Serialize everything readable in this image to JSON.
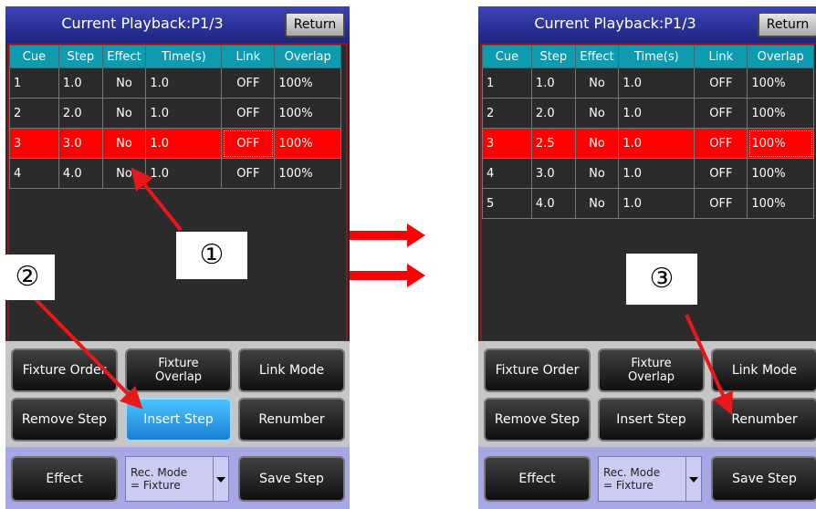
{
  "left": {
    "title": "Current Playback:P1/3",
    "return_label": "Return",
    "columns": [
      "Cue",
      "Step",
      "Effect",
      "Time(s)",
      "Link",
      "Overlap"
    ],
    "rows": [
      {
        "cue": "1",
        "step": "1.0",
        "effect": "No",
        "time": "1.0",
        "link": "OFF",
        "overlap": "100%"
      },
      {
        "cue": "2",
        "step": "2.0",
        "effect": "No",
        "time": "1.0",
        "link": "OFF",
        "overlap": "100%"
      },
      {
        "cue": "3",
        "step": "3.0",
        "effect": "No",
        "time": "1.0",
        "link": "OFF",
        "overlap": "100%"
      },
      {
        "cue": "4",
        "step": "4.0",
        "effect": "No",
        "time": "1.0",
        "link": "OFF",
        "overlap": "100%"
      }
    ],
    "buttons": {
      "fixture_order": "Fixture Order",
      "fixture_overlap_1": "Fixture",
      "fixture_overlap_2": "Overlap",
      "link_mode": "Link Mode",
      "remove_step": "Remove Step",
      "insert_step": "Insert Step",
      "renumber": "Renumber",
      "effect": "Effect",
      "rec_mode_1": "Rec. Mode",
      "rec_mode_2": "= Fixture",
      "save_step": "Save Step"
    }
  },
  "right": {
    "title": "Current Playback:P1/3",
    "return_label": "Return",
    "columns": [
      "Cue",
      "Step",
      "Effect",
      "Time(s)",
      "Link",
      "Overlap"
    ],
    "rows": [
      {
        "cue": "1",
        "step": "1.0",
        "effect": "No",
        "time": "1.0",
        "link": "OFF",
        "overlap": "100%"
      },
      {
        "cue": "2",
        "step": "2.0",
        "effect": "No",
        "time": "1.0",
        "link": "OFF",
        "overlap": "100%"
      },
      {
        "cue": "3",
        "step": "2.5",
        "effect": "No",
        "time": "1.0",
        "link": "OFF",
        "overlap": "100%"
      },
      {
        "cue": "4",
        "step": "3.0",
        "effect": "No",
        "time": "1.0",
        "link": "OFF",
        "overlap": "100%"
      },
      {
        "cue": "5",
        "step": "4.0",
        "effect": "No",
        "time": "1.0",
        "link": "OFF",
        "overlap": "100%"
      }
    ],
    "buttons": {
      "fixture_order": "Fixture Order",
      "fixture_overlap_1": "Fixture",
      "fixture_overlap_2": "Overlap",
      "link_mode": "Link Mode",
      "remove_step": "Remove Step",
      "insert_step": "Insert Step",
      "renumber": "Renumber",
      "effect": "Effect",
      "rec_mode_1": "Rec. Mode",
      "rec_mode_2": "= Fixture",
      "save_step": "Save Step"
    }
  },
  "annotations": {
    "marker_1": "①",
    "marker_2": "②",
    "marker_3": "③"
  },
  "colors": {
    "selected_row": "#ff0000",
    "header_bg": "#0e9bb0",
    "active_button": "#3aa8f0",
    "annotation_arrow": "#e8171b"
  }
}
